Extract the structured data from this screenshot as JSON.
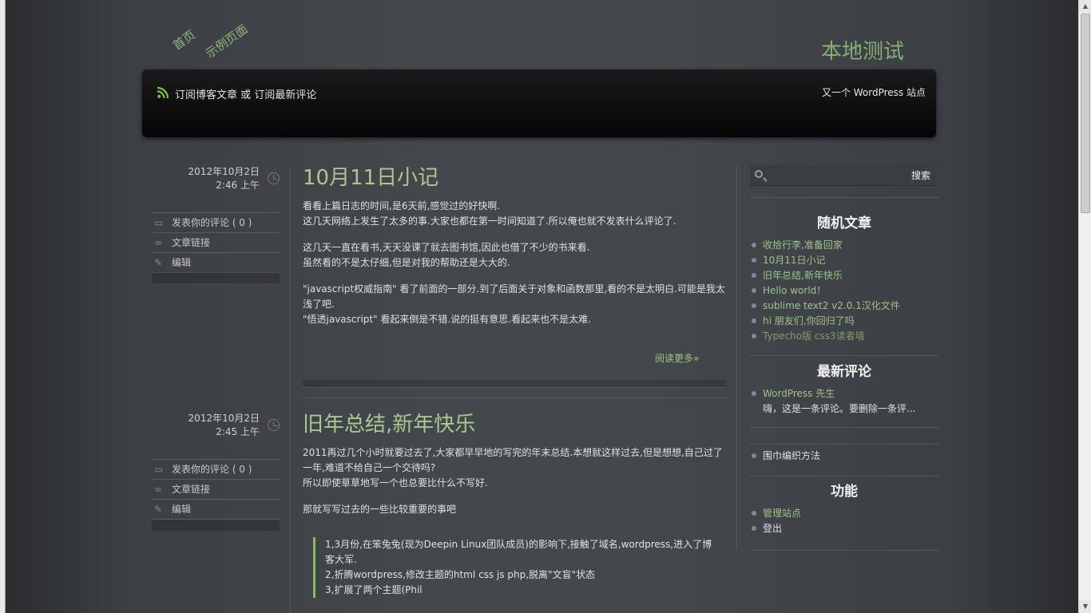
{
  "nav": {
    "home": "首页",
    "sample_page": "示例页面"
  },
  "site": {
    "title": "本地测试",
    "tagline": "又一个 WordPress 站点"
  },
  "header": {
    "subscribe_posts": "订阅博客文章",
    "or": "或",
    "subscribe_comments": "订阅最新评论"
  },
  "posts": [
    {
      "date": "2012年10月2日",
      "time": "2:46 上午",
      "actions": {
        "comment": "发表你的评论 ( 0 )",
        "permalink": "文章链接",
        "edit": "编辑"
      },
      "title": "10月11日小记",
      "paragraphs": [
        "看看上篇日志的时间,是6天前,感觉过的好快啊.",
        "这几天网络上发生了太多的事.大家也都在第一时间知道了.所以俺也就不发表什么评论了.",
        "这几天一直在看书,天天没课了就去图书馆,因此也借了不少的书来看.",
        "虽然看的不是太仔细,但是对我的帮助还是大大的.",
        "\"javascript权威指南\" 看了前面的一部分.到了后面关于对象和函数那里,看的不是太明白.可能是我太浅了吧.",
        "\"悟透javascript\" 看起来倒是不错.说的挺有意思.看起来也不是太难."
      ],
      "read_more": "阅读更多»"
    },
    {
      "date": "2012年10月2日",
      "time": "2:45 上午",
      "actions": {
        "comment": "发表你的评论 ( 0 )",
        "permalink": "文章链接",
        "edit": "编辑"
      },
      "title": "旧年总结,新年快乐",
      "paragraphs": [
        "2011再过几个小时就要过去了,大家都早早地的写完的年末总结.本想就这样过去,但是想想,自己过了一年,难道不给自己一个交待吗?",
        "所以即使草草地写一个也总要比什么不写好.",
        "那就写写过去的一些比较重要的事吧"
      ],
      "quote_lines": [
        "1,3月份,在笨兔兔(现为Deepin Linux团队成员)的影响下,接触了域名,wordpress,进入了博客大军.",
        "2,折腾wordpress,修改主题的html css js php,脱离\"文盲\"状态",
        "3,扩展了两个主题(Phil"
      ]
    }
  ],
  "sidebar": {
    "search_button": "搜索",
    "search_placeholder": "",
    "random_posts": {
      "title": "随机文章",
      "items": [
        "收拾行李,准备回家",
        "10月11日小记",
        "旧年总结,新年快乐",
        "Hello world！",
        "sublime text2 v2.0.1汉化文件",
        "hi 朋友们,你回归了吗",
        "Typecho版 css3读者墙"
      ]
    },
    "recent_comments": {
      "title": "最新评论",
      "author": "WordPress 先生",
      "excerpt": "嗨，这是一条评论。要删除一条评..."
    },
    "links": {
      "items": [
        "围巾编织方法"
      ]
    },
    "meta": {
      "title": "功能",
      "items": [
        "管理站点",
        "登出"
      ]
    }
  },
  "colors": {
    "accent_green": "#9cc487",
    "title_green": "#a8c890",
    "rss_orange": "#7ec24d",
    "background": "#44474c",
    "header_black": "#0a0a0a"
  }
}
